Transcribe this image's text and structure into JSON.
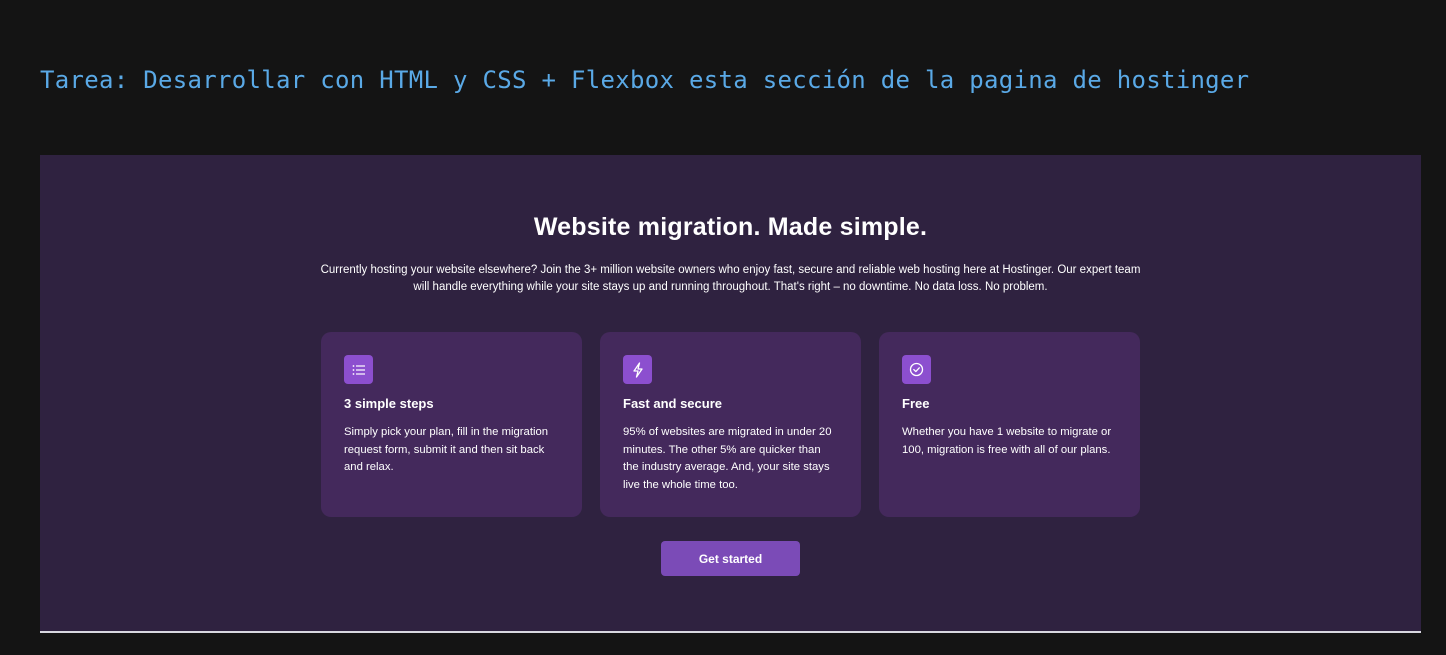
{
  "task_heading": "Tarea: Desarrollar con HTML y CSS + Flexbox esta sección de la pagina de hostinger",
  "section": {
    "title": "Website migration. Made simple.",
    "intro": "Currently hosting your website elsewhere? Join the 3+ million website owners who enjoy fast, secure and reliable web hosting here at Hostinger. Our expert team will handle everything while your site stays up and running throughout. That's right – no downtime. No data loss. No problem.",
    "cards": [
      {
        "icon": "list-icon",
        "title": "3 simple steps",
        "text": "Simply pick your plan, fill in the migration request form, submit it and then sit back and relax."
      },
      {
        "icon": "lightning-icon",
        "title": "Fast and secure",
        "text": "95% of websites are migrated in under 20 minutes. The other 5% are quicker than the industry average. And, your site stays live the whole time too."
      },
      {
        "icon": "check-circle-icon",
        "title": "Free",
        "text": "Whether you have 1 website to migrate or 100, migration is free with all of our plans."
      }
    ],
    "cta_label": "Get started"
  },
  "colors": {
    "task_heading": "#5aa9e6",
    "section_bg": "#2f2240",
    "card_bg": "#44295c",
    "icon_bg": "#8c4fcf",
    "cta_bg": "#7b4bb7"
  }
}
